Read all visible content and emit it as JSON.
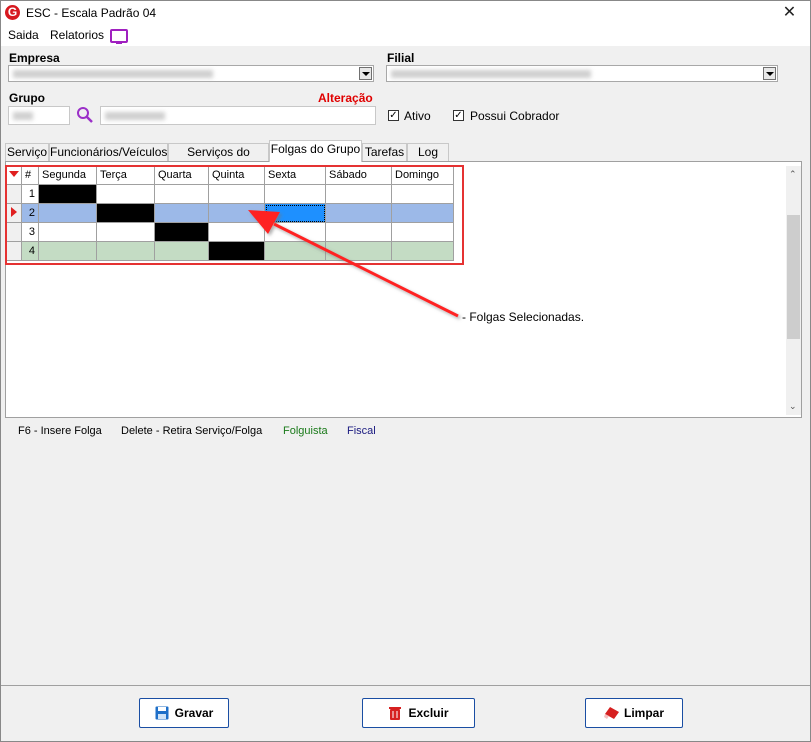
{
  "window": {
    "title": "ESC - Escala Padrão 04",
    "app_icon": "G",
    "close": "✕"
  },
  "menu": {
    "items": [
      "Saida",
      "Relatorios"
    ],
    "monitor_icon": "monitor-icon"
  },
  "form": {
    "empresa_label": "Empresa",
    "filial_label": "Filial",
    "grupo_label": "Grupo",
    "mode_label": "Alteração",
    "mode_color": "#e00000",
    "ativo_label": "Ativo",
    "ativo_checked": true,
    "possui_cobrador_label": "Possui Cobrador",
    "possui_cobrador_checked": true,
    "search_icon": "magnifier-icon"
  },
  "tabs": [
    "Serviço",
    "Funcionários/Veículos",
    "Serviços do Grupo",
    "Folgas do Grupo",
    "Tarefas",
    "Log"
  ],
  "active_tab": "Folgas do Grupo",
  "grid": {
    "columns": [
      "#",
      "Segunda",
      "Terça",
      "Quarta",
      "Quinta",
      "Sexta",
      "Sábado",
      "Domingo"
    ],
    "rows": [
      {
        "num": "1",
        "folga": "Segunda"
      },
      {
        "num": "2",
        "folga": "Terça",
        "current": true,
        "selected_cell": "Sexta"
      },
      {
        "num": "3",
        "folga": "Quarta"
      },
      {
        "num": "4",
        "folga": "Quinta"
      }
    ],
    "colors": {
      "folga": "#000000",
      "current_row": "#9cb9e8",
      "folguista_row": "#c4dcc4",
      "selected_cell": "#1e90ff"
    }
  },
  "annotation": {
    "text": "- Folgas Selecionadas.",
    "color": "#ff2020"
  },
  "legend": {
    "insert": "F6 - Insere Folga",
    "delete": "Delete - Retira Serviço/Folga",
    "folguista": "Folguista",
    "folguista_color": "#1a7a1a",
    "fiscal": "Fiscal",
    "fiscal_color": "#1a1a80"
  },
  "buttons": {
    "gravar": "Gravar",
    "excluir": "Excluir",
    "limpar": "Limpar"
  }
}
